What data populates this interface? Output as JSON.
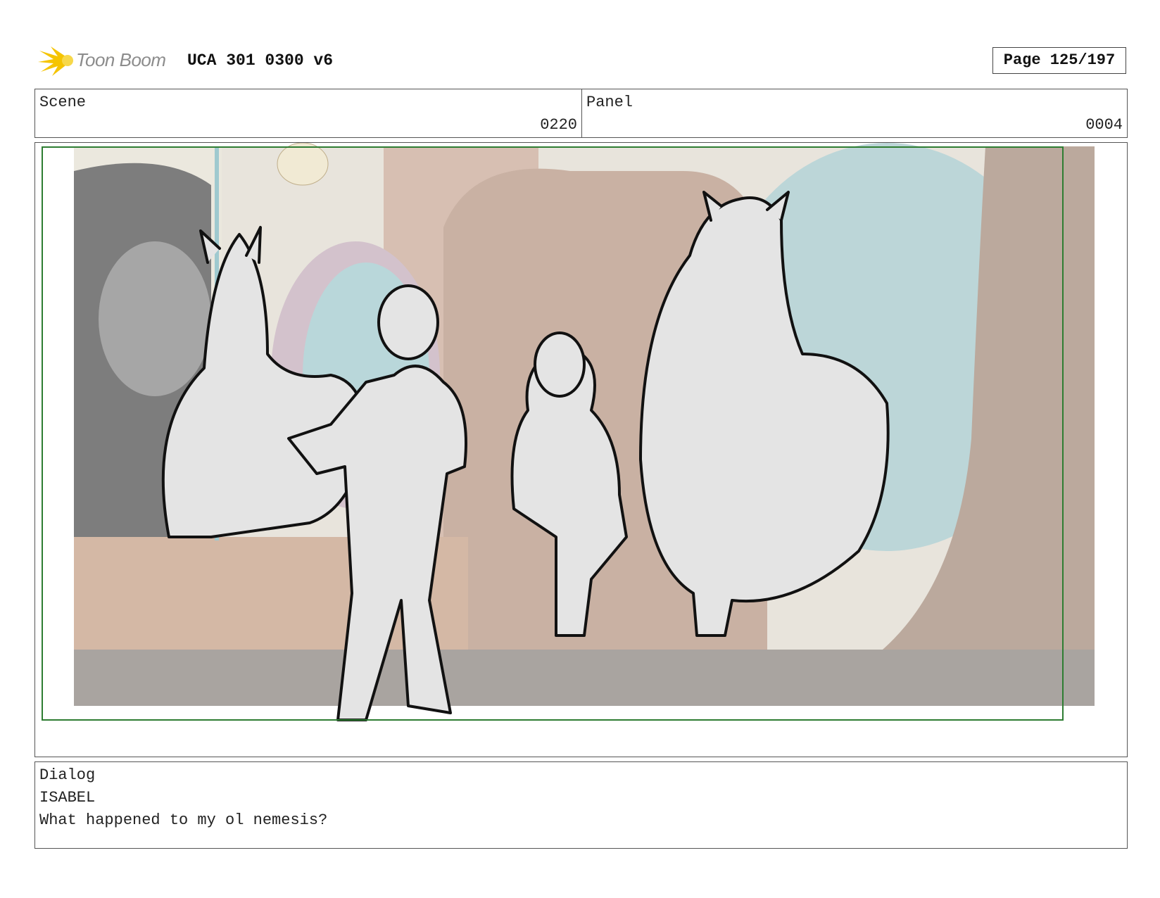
{
  "header": {
    "logo_text": "Toon Boom",
    "title": "UCA 301 0300 v6",
    "page": "Page 125/197"
  },
  "scene": {
    "label": "Scene",
    "value": "0220"
  },
  "panel": {
    "label": "Panel",
    "value": "0004"
  },
  "dialog": {
    "label": "Dialog",
    "character": "ISABEL",
    "line": "What happened to my ol nemesis?"
  },
  "colors": {
    "logo_accent": "#f5c400",
    "safe_frame": "#2e7d32",
    "background_wall": "#d9c4b3"
  }
}
